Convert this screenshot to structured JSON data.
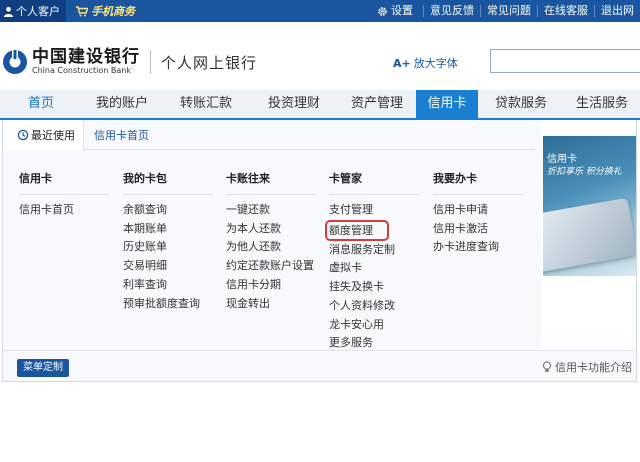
{
  "topbar": {
    "personal_label": "个人客户",
    "business_label": "手机商务",
    "links": [
      "设置",
      "意见反馈",
      "常见问题",
      "在线客服",
      "退出网"
    ]
  },
  "header": {
    "bank_name_cn": "中国建设银行",
    "bank_name_en": "China Construction Bank",
    "section_title": "个人网上银行",
    "zoom_label": "放大字体",
    "zoom_icon": "A+",
    "search_placeholder": ""
  },
  "nav": {
    "items": [
      "首页",
      "我的账户",
      "转账汇款",
      "投资理财",
      "资产管理",
      "信用卡",
      "贷款服务",
      "生活服务"
    ],
    "active_index": 5
  },
  "menu": {
    "recent_label": "最近使用",
    "recent_link": "信用卡首页",
    "columns": [
      {
        "title": "信用卡",
        "items": [
          "信用卡首页"
        ]
      },
      {
        "title": "我的卡包",
        "items": [
          "余额查询",
          "本期账单",
          "历史账单",
          "交易明细",
          "利率查询",
          "预审批额度查询"
        ]
      },
      {
        "title": "卡账往来",
        "items": [
          "一键还款",
          "为本人还款",
          "为他人还款",
          "约定还款账户设置",
          "信用卡分期",
          "现金转出"
        ]
      },
      {
        "title": "卡管家",
        "items": [
          "支付管理",
          "额度管理",
          "消息服务定制",
          "虚拟卡",
          "挂失及换卡",
          "个人资料修改",
          "龙卡安心用",
          "更多服务"
        ]
      },
      {
        "title": "我要办卡",
        "items": [
          "信用卡申请",
          "信用卡激活",
          "办卡进度查询"
        ]
      }
    ],
    "highlighted_item": "额度管理",
    "promo": {
      "title": "信用卡",
      "subtitle": "折扣享乐 积分换礼"
    },
    "custom_button": "菜单定制",
    "intro_link": "信用卡功能介绍"
  }
}
